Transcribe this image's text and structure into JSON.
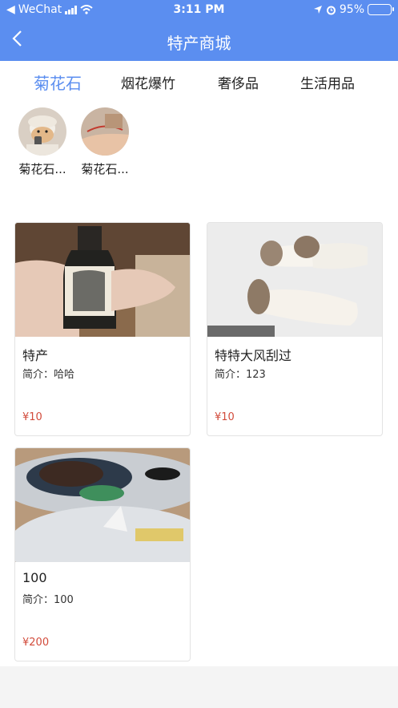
{
  "status_bar": {
    "carrier": "WeChat",
    "time": "3:11 PM",
    "battery": "95%"
  },
  "header": {
    "title": "特产商城"
  },
  "tabs": [
    {
      "label": "菊花石",
      "active": true
    },
    {
      "label": "烟花爆竹"
    },
    {
      "label": "奢侈品"
    },
    {
      "label": "生活用品"
    }
  ],
  "subcategories": [
    {
      "label": "菊花石..."
    },
    {
      "label": "菊花石..."
    }
  ],
  "products": [
    {
      "name": "特产",
      "intro": "简介：哈哈",
      "price": "¥10"
    },
    {
      "name": "特特大风刮过",
      "intro": "简介：123",
      "price": "¥10"
    },
    {
      "name": "100",
      "intro": "简介：100",
      "price": "¥200"
    }
  ],
  "colors": {
    "accent": "#5b8ef0",
    "price": "#d24b3b"
  }
}
